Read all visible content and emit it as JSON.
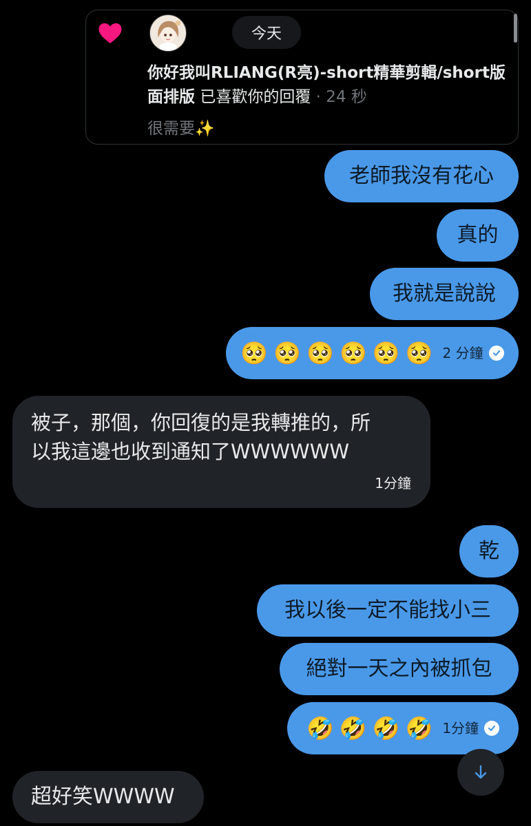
{
  "notification": {
    "date_label": "今天",
    "name": "你好我叫RLIANG(R亮)-short精華剪輯/short版面排版",
    "action": "已喜歡你的回覆",
    "time": "· 24 秒",
    "quote": "很需要✨"
  },
  "messages": [
    {
      "text": "老師我沒有花心"
    },
    {
      "text": "真的"
    },
    {
      "text": "我就是說說"
    },
    {
      "emojis": [
        "🥺",
        "🥺",
        "🥺",
        "🥺",
        "🥺",
        "🥺"
      ],
      "time": "2 分鐘"
    },
    {
      "text_line1": "被子，那個，你回復的是我轉推的，所",
      "text_line2": "以我這邊也收到通知了WWWWWW",
      "time": "1分鐘"
    },
    {
      "text": "乾"
    },
    {
      "text": "我以後一定不能找小三"
    },
    {
      "text": "絕對一天之內被抓包"
    },
    {
      "emojis": [
        "🤣",
        "🤣",
        "🤣",
        "🤣"
      ],
      "time": "1分鐘"
    },
    {
      "text": "超好笑WWWW"
    }
  ],
  "colors": {
    "background": "#000000",
    "outgoing_bubble": "#4a99e9",
    "incoming_bubble": "#202327",
    "heart": "#f91880",
    "muted_text": "#71767b"
  },
  "icons": {
    "like": "heart-icon",
    "sent_status": "check-icon",
    "scroll": "arrow-down-icon"
  }
}
